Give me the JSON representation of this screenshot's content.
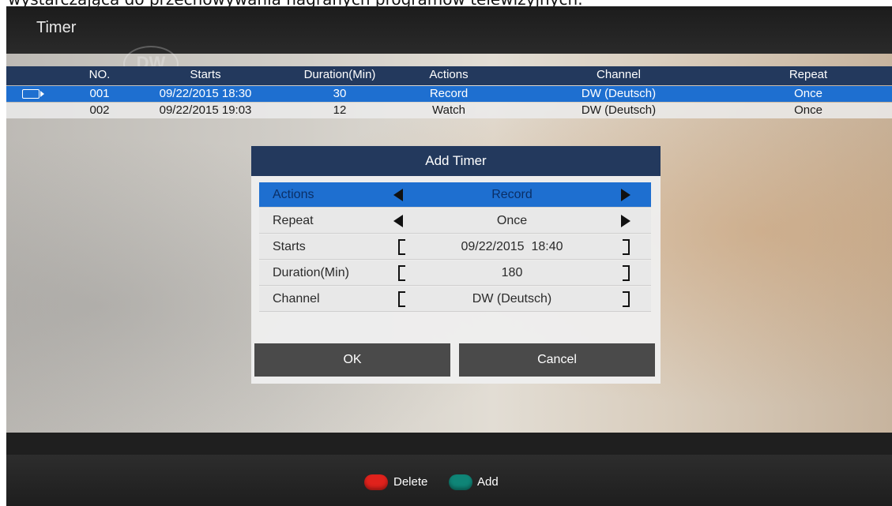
{
  "caption": "wystarczająca do przechowywania nagranych programów telewizyjnych.",
  "screen": {
    "title": "Timer",
    "channel_logo": "DW",
    "table": {
      "columns": [
        "NO.",
        "Starts",
        "Duration(Min)",
        "Actions",
        "Channel",
        "Repeat"
      ],
      "rows": [
        {
          "no": "001",
          "starts": "09/22/2015 18:30",
          "duration": "30",
          "action": "Record",
          "channel": "DW (Deutsch)",
          "repeat": "Once",
          "selected": true,
          "icon": "recording-camera-icon"
        },
        {
          "no": "002",
          "starts": "09/22/2015 19:03",
          "duration": "12",
          "action": "Watch",
          "channel": "DW (Deutsch)",
          "repeat": "Once",
          "selected": false
        }
      ]
    },
    "dialog": {
      "title": "Add Timer",
      "fields": [
        {
          "label": "Actions",
          "value": "Record"
        },
        {
          "label": "Repeat",
          "value": "Once"
        },
        {
          "label": "Starts",
          "value": "09/22/2015  18:40"
        },
        {
          "label": "Duration(Min)",
          "value": "180"
        },
        {
          "label": "Channel",
          "value": "DW (Deutsch)"
        }
      ],
      "ok_label": "OK",
      "cancel_label": "Cancel"
    },
    "footer": {
      "delete_label": "Delete",
      "add_label": "Add"
    }
  },
  "colors": {
    "header_bar": "#23395d",
    "selection": "#1e6fd0",
    "red_key": "#e0221c",
    "green_key": "#0f8577"
  }
}
